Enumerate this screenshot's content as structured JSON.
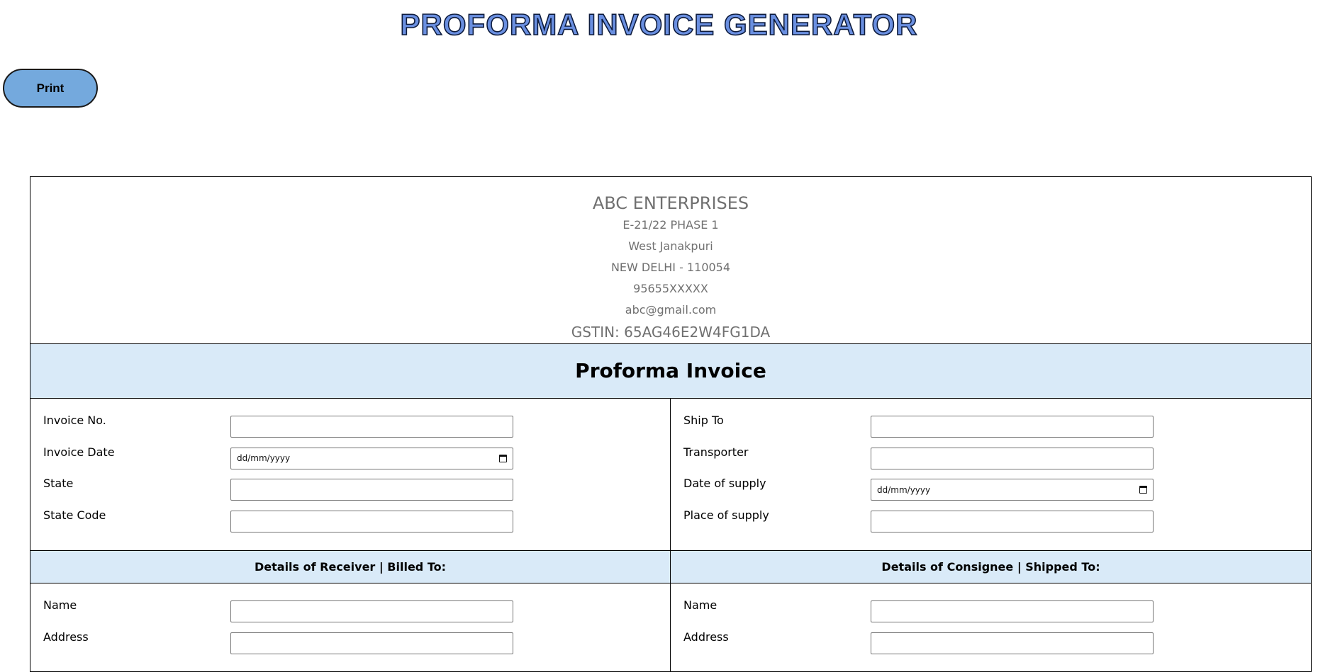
{
  "header": {
    "title": "PROFORMA INVOICE GENERATOR",
    "print_label": "Print"
  },
  "company": {
    "name": "ABC ENTERPRISES",
    "address_line1": "E-21/22 PHASE 1",
    "address_line2": "West Janakpuri",
    "city_pin": "NEW DELHI - 110054",
    "phone": "95655XXXXX",
    "email": "abc@gmail.com",
    "gstin": "GSTIN: 65AG46E2W4FG1DA"
  },
  "invoice": {
    "title": "Proforma Invoice",
    "left_fields": {
      "invoice_no": {
        "label": "Invoice No.",
        "value": ""
      },
      "invoice_date": {
        "label": "Invoice Date",
        "placeholder": "dd/mm/yyyy"
      },
      "state": {
        "label": "State",
        "value": ""
      },
      "state_code": {
        "label": "State Code",
        "value": ""
      }
    },
    "right_fields": {
      "ship_to": {
        "label": "Ship To",
        "value": ""
      },
      "transporter": {
        "label": "Transporter",
        "value": ""
      },
      "date_of_supply": {
        "label": "Date of supply",
        "placeholder": "dd/mm/yyyy"
      },
      "place_of_supply": {
        "label": "Place of supply",
        "value": ""
      }
    }
  },
  "receiver": {
    "heading": "Details of Receiver | Billed To:",
    "name_label": "Name",
    "address_label": "Address"
  },
  "consignee": {
    "heading": "Details of Consignee | Shipped To:",
    "name_label": "Name",
    "address_label": "Address"
  },
  "colors": {
    "title_fill": "#6a8fe0",
    "title_stroke": "#0d1b3d",
    "print_button": "#74a9dd",
    "band": "#d9eaf8",
    "company_text": "#707070"
  }
}
